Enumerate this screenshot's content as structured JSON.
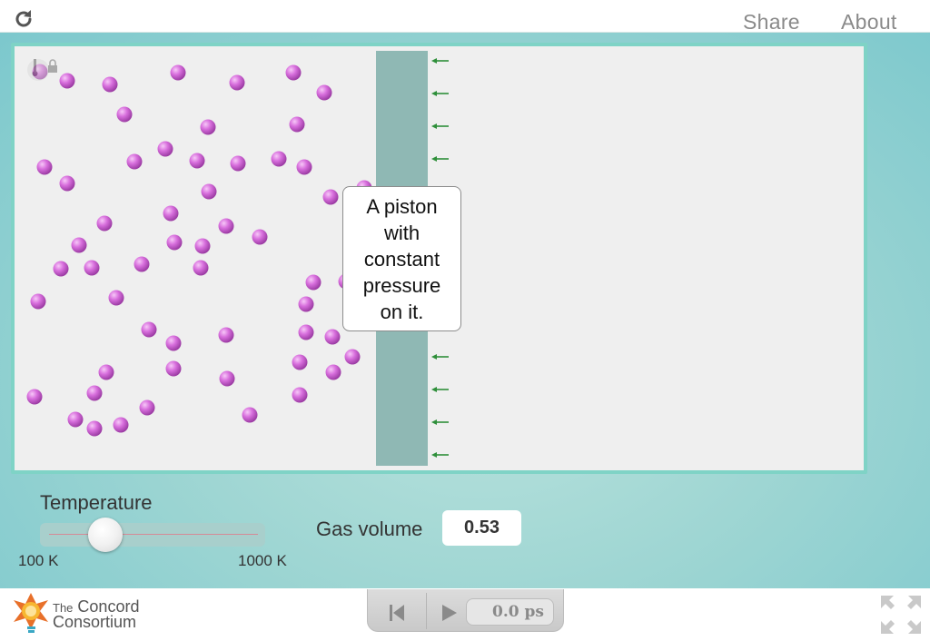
{
  "topbar": {
    "share_label": "Share",
    "about_label": "About",
    "reload_icon": "reload-icon"
  },
  "simulation": {
    "callout_text": "A piston with constant pressure on it.",
    "piston_color": "#8fb8b4",
    "molecule_color": "#d66fdc",
    "arrow_color": "#2e8f3a",
    "panel_border_color": "#7fd3c6",
    "molecule_count": 71,
    "overlay_icons": [
      "thermometer-icon",
      "lock-icon"
    ]
  },
  "controls": {
    "temperature_label": "Temperature",
    "temperature_min_label": "100 K",
    "temperature_max_label": "1000 K",
    "temperature_slider_value": 0.28,
    "gas_volume_label": "Gas volume",
    "gas_volume_value": "0.53"
  },
  "footer": {
    "logo_line1_small": "The",
    "logo_line1": "Concord",
    "logo_line2": "Consortium",
    "time_display": "0.0 ps",
    "reset_icon": "skip-back-icon",
    "play_icon": "play-icon",
    "fullscreen_icon": "fullscreen-icon"
  }
}
